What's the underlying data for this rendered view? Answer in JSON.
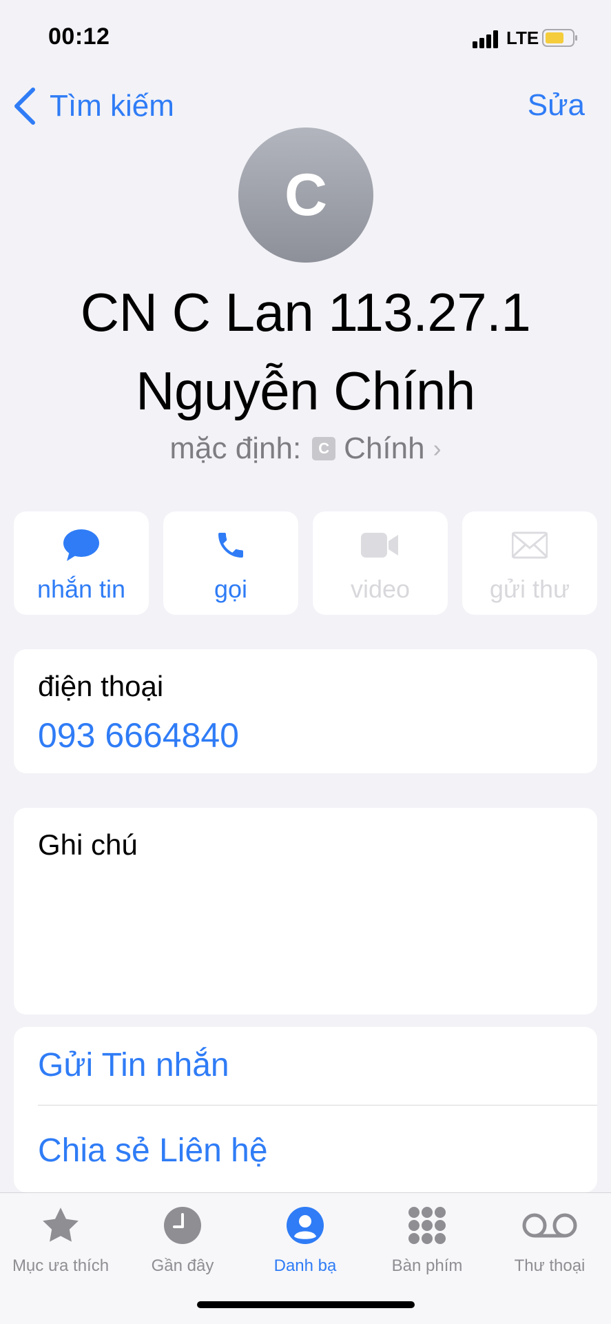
{
  "status_bar": {
    "time": "00:12",
    "network": "LTE"
  },
  "nav": {
    "back_label": "Tìm kiếm",
    "edit_label": "Sửa"
  },
  "contact": {
    "avatar_letter": "C",
    "name_line1": "CN C Lan 113.27.1",
    "name_line2": "Nguyễn Chính",
    "default_label": "mặc định:",
    "default_badge": "C",
    "default_value": "Chính"
  },
  "actions": [
    {
      "label": "nhắn tin",
      "icon": "message-bubble-icon",
      "enabled": true
    },
    {
      "label": "gọi",
      "icon": "phone-icon",
      "enabled": true
    },
    {
      "label": "video",
      "icon": "video-camera-icon",
      "enabled": false
    },
    {
      "label": "gửi thư",
      "icon": "envelope-icon",
      "enabled": false
    }
  ],
  "phone": {
    "label": "điện thoại",
    "value": "093 6664840"
  },
  "notes": {
    "label": "Ghi chú"
  },
  "links": {
    "send_message": "Gửi Tin nhắn",
    "share_contact": "Chia sẻ Liên hệ"
  },
  "tabs": [
    {
      "label": "Mục ưa thích",
      "icon": "star-icon",
      "active": false
    },
    {
      "label": "Gần đây",
      "icon": "clock-icon",
      "active": false
    },
    {
      "label": "Danh bạ",
      "icon": "person-circle-icon",
      "active": true
    },
    {
      "label": "Bàn phím",
      "icon": "keypad-icon",
      "active": false
    },
    {
      "label": "Thư thoại",
      "icon": "voicemail-icon",
      "active": false
    }
  ],
  "colors": {
    "accent": "#2f7cf6",
    "background": "#f2f2f7",
    "disabled": "#d8d8dc",
    "tab_inactive": "#8e8e93"
  }
}
